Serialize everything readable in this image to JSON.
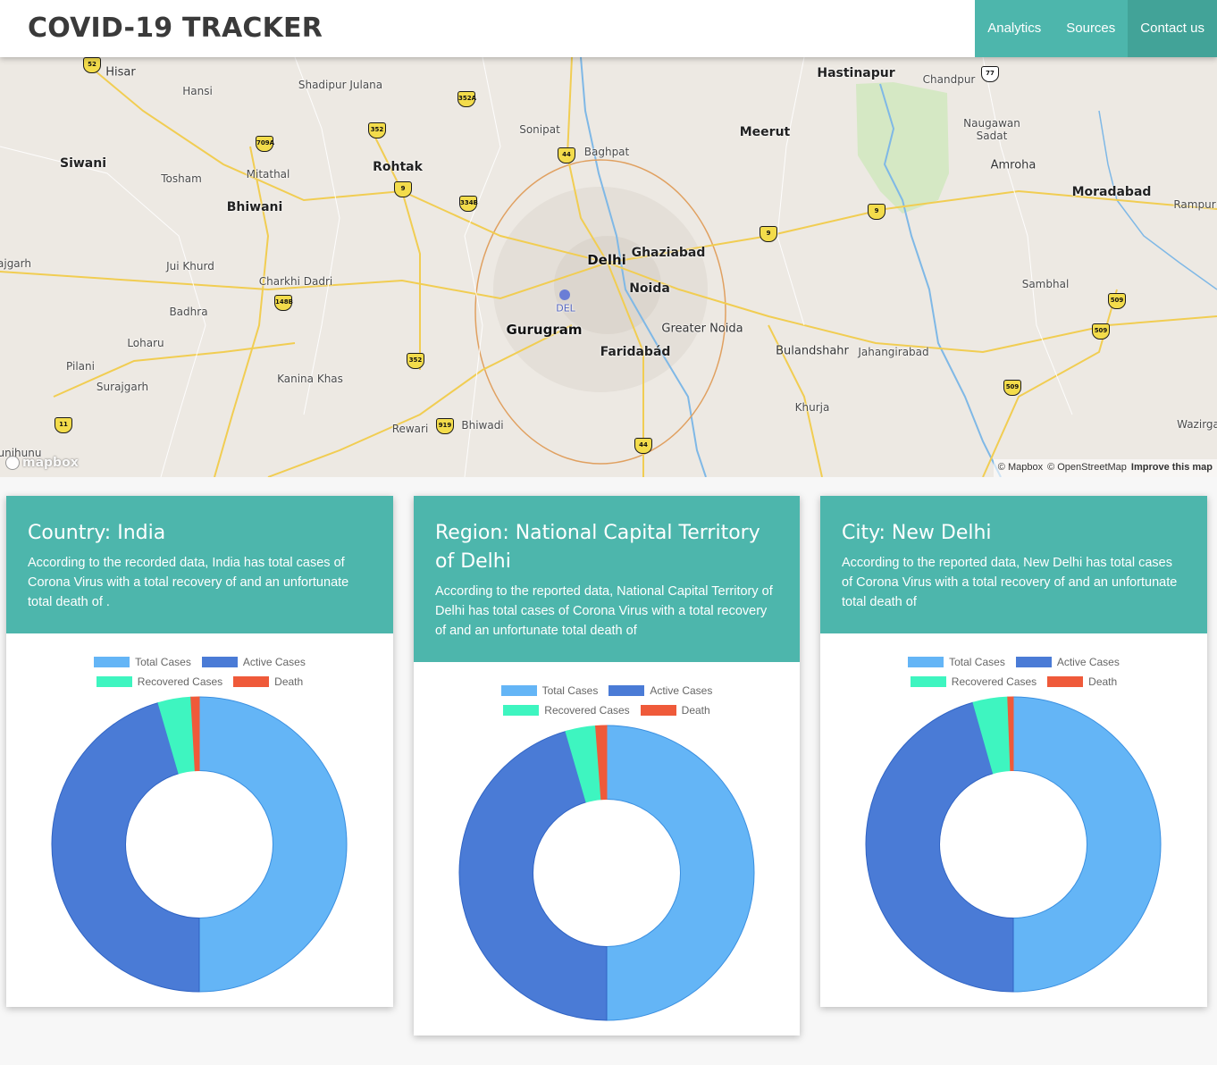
{
  "header": {
    "brand": "COVID-19 TRACKER",
    "nav": [
      {
        "label": "Analytics"
      },
      {
        "label": "Sources"
      },
      {
        "label": "Contact us"
      }
    ]
  },
  "map": {
    "labels": {
      "hisar": "Hisar",
      "hansi": "Hansi",
      "shadipur": "Shadipur Julana",
      "sonipat": "Sonipat",
      "baghpat": "Baghpat",
      "meerut": "Meerut",
      "hastinapur": "Hastinapur",
      "chandpur": "Chandpur",
      "naugawan": "Naugawan",
      "sadat": "Sadat",
      "amroha": "Amroha",
      "moradabad": "Moradabad",
      "rampur": "Rampur",
      "siwani": "Siwani",
      "tosham": "Tosham",
      "mitathal": "Mitathal",
      "rohtak": "Rohtak",
      "bhiwani": "Bhiwani",
      "delhi": "Delhi",
      "ghaziabad": "Ghaziabad",
      "noida": "Noida",
      "jagarh": "ajgarh",
      "juikhurd": "Jui Khurd",
      "charkhi": "Charkhi Dadri",
      "badhra": "Badhra",
      "loharu": "Loharu",
      "pilani": "Pilani",
      "surajgarh": "Surajgarh",
      "kanina": "Kanina Khas",
      "gurugram": "Gurugram",
      "del": "DEL",
      "faridabad": "Faridabád",
      "greaternoida": "Greater Noida",
      "bulandshahr": "Bulandshahr",
      "jahangirabad": "Jahangirabad",
      "sambhal": "Sambhal",
      "khurja": "Khurja",
      "rewari": "Rewari",
      "bhiwadi": "Bhiwadi",
      "wazirg": "Wazirga",
      "jhunu": "unjhunu"
    },
    "shields": [
      "52",
      "352A",
      "352",
      "709A",
      "44",
      "9",
      "334B",
      "9",
      "9",
      "148B",
      "352",
      "11",
      "919",
      "44",
      "509",
      "509",
      "509",
      "77"
    ],
    "logo": "mapbox",
    "attribution": {
      "mapbox": "© Mapbox",
      "osm": "© OpenStreetMap",
      "improve": "Improve this map"
    }
  },
  "colors": {
    "accent": "#4db6ac",
    "total": "#64b5f6",
    "active": "#4a7bd6",
    "recovered": "#3ef5c0",
    "death": "#ef5a3a"
  },
  "legend": {
    "total": "Total Cases",
    "active": "Active Cases",
    "recovered": "Recovered Cases",
    "death": "Death"
  },
  "cards": [
    {
      "title": "Country: India",
      "text": "According to the recorded data, India has total cases of Corona Virus with a total recovery of and an unfortunate total death of ."
    },
    {
      "title": "Region: National Capital Territory of Delhi",
      "text": "According to the reported data, National Capital Territory of Delhi has total cases of Corona Virus with a total recovery of and an unfortunate total death of"
    },
    {
      "title": "City: New Delhi",
      "text": "According to the reported data, New Delhi has total cases of Corona Virus with a total recovery of and an unfortunate total death of"
    }
  ],
  "chart_data": [
    {
      "type": "pie",
      "categories": [
        "Total Cases",
        "Active Cases",
        "Recovered Cases",
        "Death"
      ],
      "values": [
        50.0,
        45.5,
        3.6,
        0.9
      ]
    },
    {
      "type": "pie",
      "categories": [
        "Total Cases",
        "Active Cases",
        "Recovered Cases",
        "Death"
      ],
      "values": [
        50.0,
        45.5,
        3.3,
        1.2
      ]
    },
    {
      "type": "pie",
      "categories": [
        "Total Cases",
        "Active Cases",
        "Recovered Cases",
        "Death"
      ],
      "values": [
        50.0,
        45.6,
        3.8,
        0.6
      ]
    }
  ]
}
